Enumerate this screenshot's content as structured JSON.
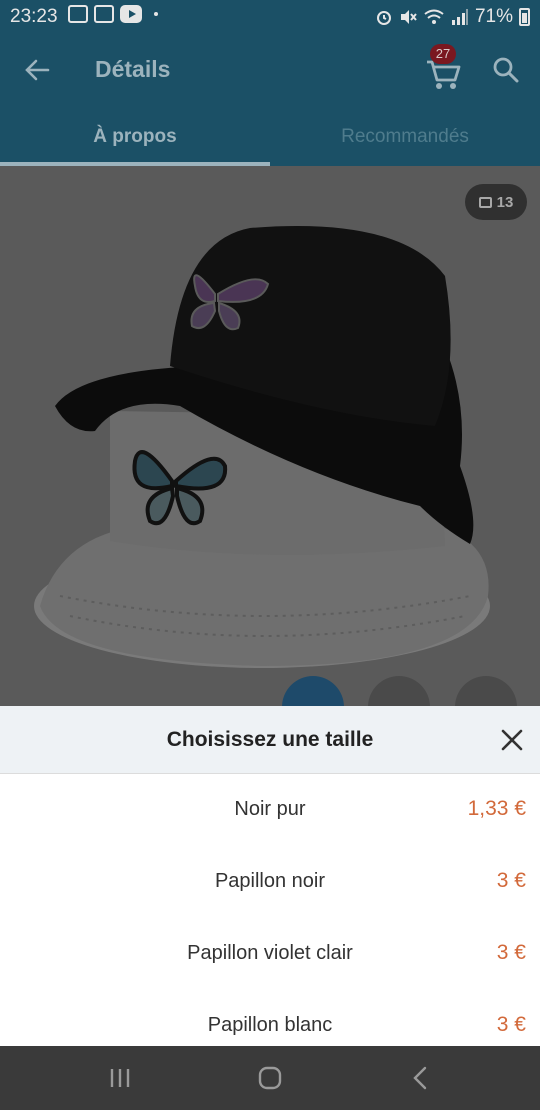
{
  "status_bar": {
    "time": "23:23",
    "battery": "71%"
  },
  "app_bar": {
    "title": "Détails",
    "cart_count": "27"
  },
  "tabs": [
    {
      "label": "À propos",
      "active": true
    },
    {
      "label": "Recommandés",
      "active": false
    }
  ],
  "product": {
    "photo_count": "13"
  },
  "sheet": {
    "title": "Choisissez une taille",
    "options": [
      {
        "name": "Noir pur",
        "price": "1,33 €"
      },
      {
        "name": "Papillon noir",
        "price": "3 €"
      },
      {
        "name": "Papillon violet clair",
        "price": "3 €"
      },
      {
        "name": "Papillon blanc",
        "price": "3 €"
      }
    ]
  },
  "colors": {
    "primary": "#1b5066",
    "price": "#d2693a",
    "badge": "#7a1820"
  },
  "icons": [
    "back-arrow-icon",
    "cart-icon",
    "search-icon",
    "image-icon",
    "close-icon",
    "recent-apps-icon",
    "home-icon",
    "back-icon"
  ]
}
